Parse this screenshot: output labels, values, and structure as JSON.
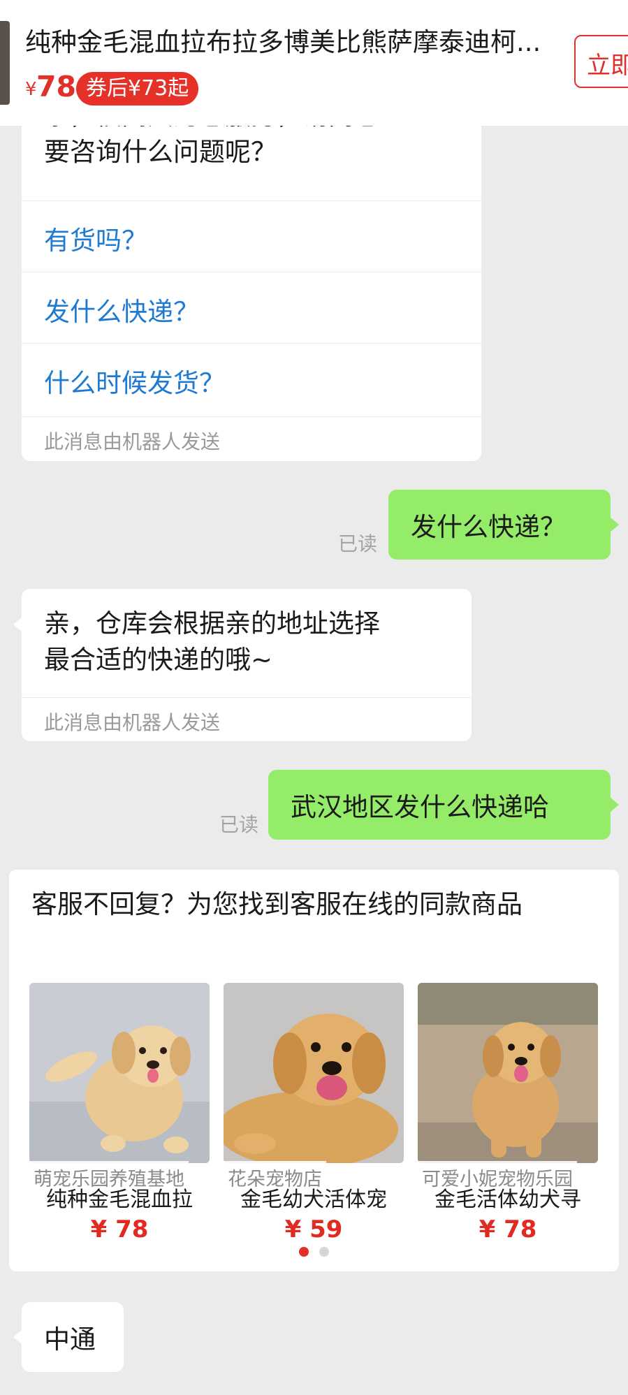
{
  "top_bar": {
    "title": "纯种金毛混血拉布拉多博美比熊萨摩泰迪柯...",
    "price_symbol": "¥",
    "price": "78",
    "coupon": "券后¥73起",
    "buy_label": "立即"
  },
  "bot_message_1": {
    "text_line_1": "亲，很高兴为您服务，请问您",
    "text_line_2": "要咨询什么问题呢？",
    "options": [
      "有货吗？",
      "发什么快递？",
      "什么时候发货？"
    ],
    "footer": "此消息由机器人发送"
  },
  "user_message_1": {
    "text": "发什么快递？",
    "status": "已读"
  },
  "bot_message_2": {
    "text_line_1": "亲，仓库会根据亲的地址选择",
    "text_line_2": "最合适的快递的哦~",
    "footer": "此消息由机器人发送"
  },
  "user_message_2": {
    "text": "武汉地区发什么快递哈",
    "status": "已读"
  },
  "recommendation": {
    "title": "客服不回复？为您找到客服在线的同款商品",
    "products": [
      {
        "shop": "萌宠乐园养殖基地",
        "name": "纯种金毛混血拉",
        "price": "¥ 78"
      },
      {
        "shop": "花朵宠物店",
        "name": "金毛幼犬活体宠",
        "price": "¥ 59"
      },
      {
        "shop": "可爱小妮宠物乐园",
        "name": "金毛活体幼犬寻",
        "price": "¥ 78"
      }
    ],
    "page_count": 2,
    "active_page": 1
  },
  "reply_message": {
    "text": "中通"
  },
  "colors": {
    "background": "#ebebeb",
    "user_bubble": "#95ec69",
    "link_blue": "#1f7ad1",
    "price_red": "#e0302a"
  }
}
